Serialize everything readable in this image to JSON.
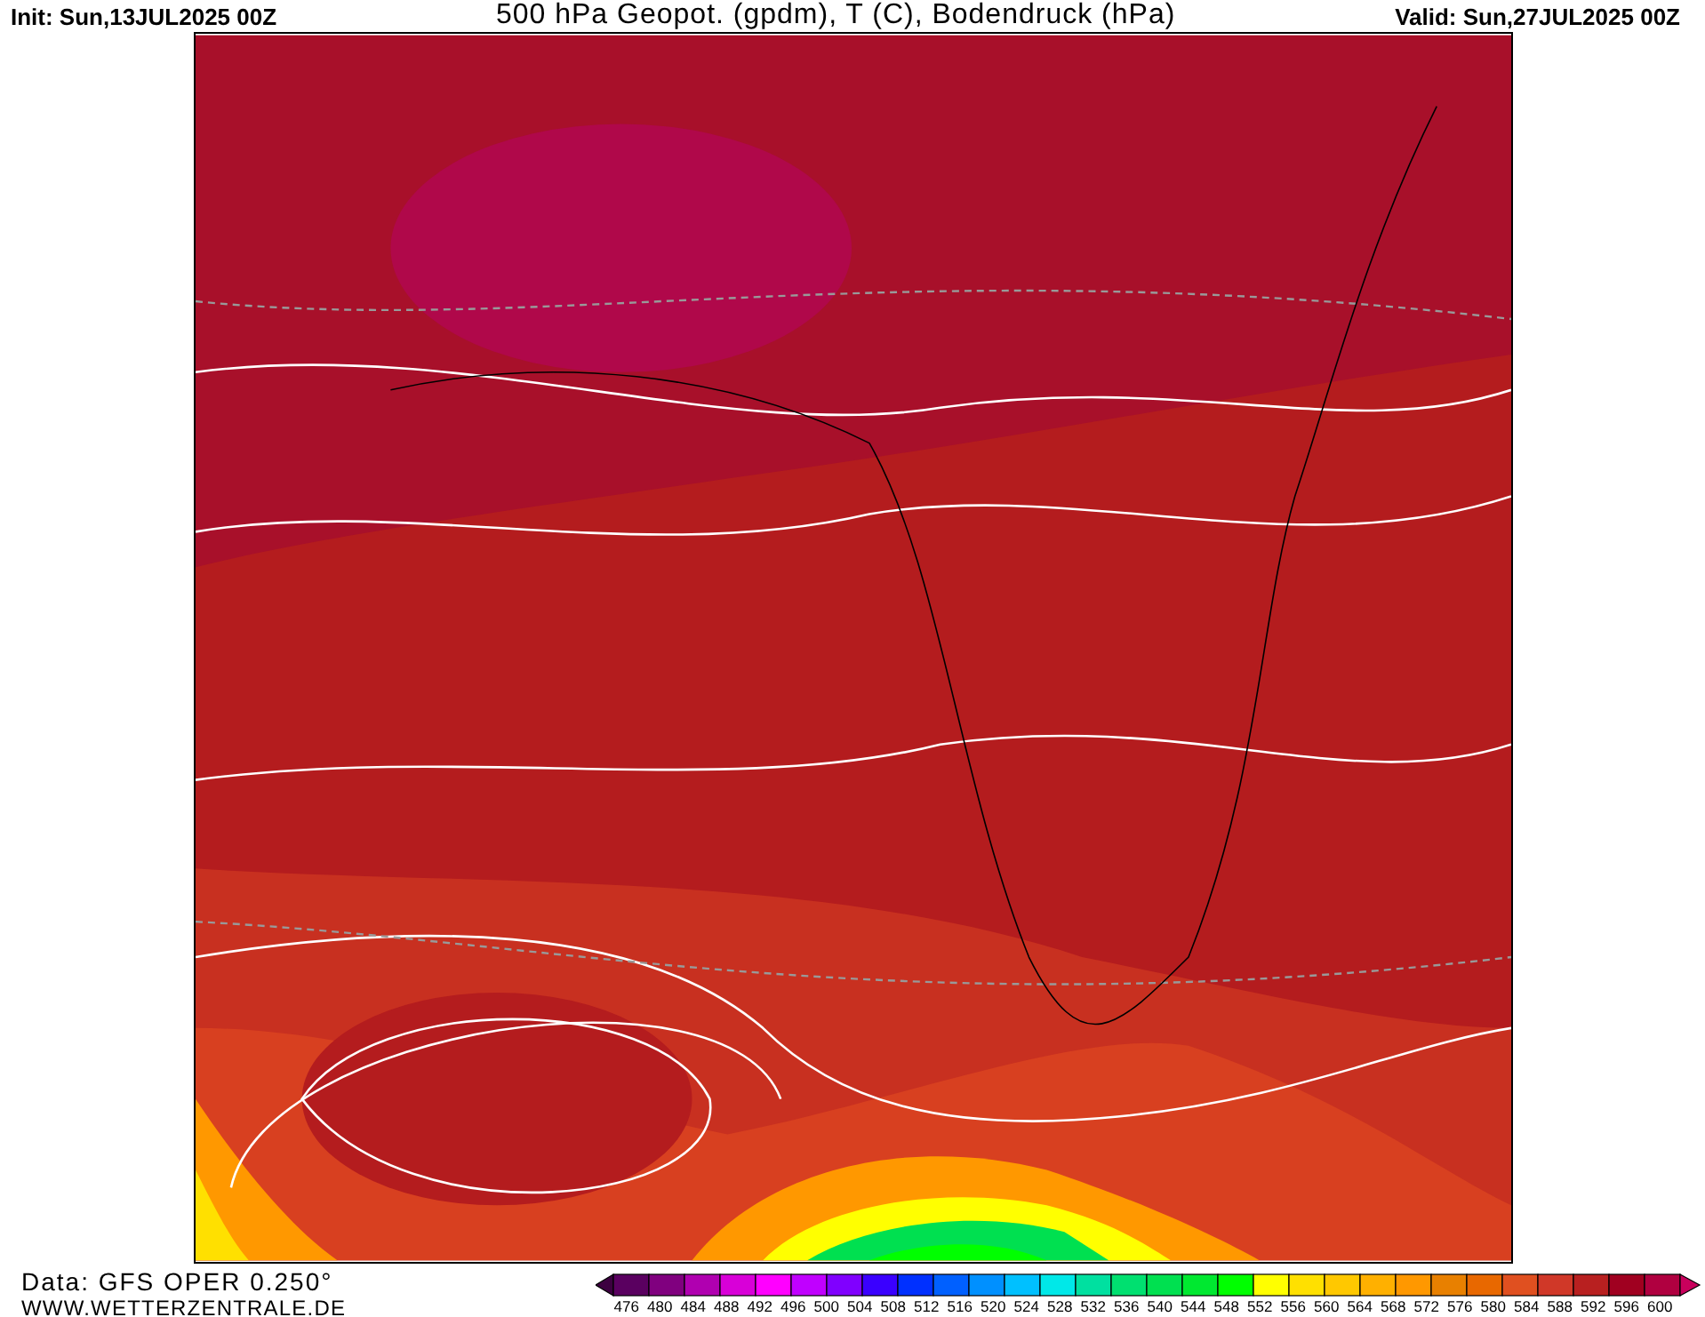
{
  "header": {
    "init": "Init: Sun,13JUL2025 00Z",
    "title": "500 hPa Geopot. (gpdm), T (C), Bodendruck (hPa)",
    "valid": "Valid: Sun,27JUL2025 00Z"
  },
  "footer": {
    "data_source": "Data: GFS OPER 0.250°",
    "website": "WWW.WETTERZENTRALE.DE"
  },
  "legend": {
    "swatches": [
      {
        "kind": "arrow_low",
        "color": "#3c0040"
      },
      {
        "kind": "box",
        "color": "#5a0060"
      },
      {
        "kind": "box",
        "color": "#80007f"
      },
      {
        "kind": "box",
        "color": "#b000b0"
      },
      {
        "kind": "box",
        "color": "#d800d8"
      },
      {
        "kind": "box",
        "color": "#ff00ff"
      },
      {
        "kind": "box",
        "color": "#c000ff"
      },
      {
        "kind": "box",
        "color": "#8000ff"
      },
      {
        "kind": "box",
        "color": "#3a00ff"
      },
      {
        "kind": "box",
        "color": "#0030ff"
      },
      {
        "kind": "box",
        "color": "#0060ff"
      },
      {
        "kind": "box",
        "color": "#0090ff"
      },
      {
        "kind": "box",
        "color": "#00c0ff"
      },
      {
        "kind": "box",
        "color": "#00e8e8"
      },
      {
        "kind": "box",
        "color": "#00e0a0"
      },
      {
        "kind": "box",
        "color": "#00e070"
      },
      {
        "kind": "box",
        "color": "#00e050"
      },
      {
        "kind": "box",
        "color": "#00e830"
      },
      {
        "kind": "box",
        "color": "#00ff00"
      },
      {
        "kind": "box",
        "color": "#ffff00"
      },
      {
        "kind": "box",
        "color": "#ffe000"
      },
      {
        "kind": "box",
        "color": "#ffc800"
      },
      {
        "kind": "box",
        "color": "#ffb000"
      },
      {
        "kind": "box",
        "color": "#ff9800"
      },
      {
        "kind": "box",
        "color": "#e88000"
      },
      {
        "kind": "box",
        "color": "#e86800"
      },
      {
        "kind": "box",
        "color": "#e05020"
      },
      {
        "kind": "box",
        "color": "#d03828"
      },
      {
        "kind": "box",
        "color": "#b82020"
      },
      {
        "kind": "box",
        "color": "#a00020"
      },
      {
        "kind": "box",
        "color": "#b00040"
      },
      {
        "kind": "arrow_high",
        "color": "#c8005c"
      }
    ],
    "ticks": [
      "476",
      "480",
      "484",
      "488",
      "492",
      "496",
      "500",
      "504",
      "508",
      "512",
      "516",
      "520",
      "524",
      "528",
      "532",
      "536",
      "540",
      "544",
      "548",
      "552",
      "556",
      "560",
      "564",
      "568",
      "572",
      "576",
      "580",
      "584",
      "588",
      "592",
      "596",
      "600"
    ]
  }
}
